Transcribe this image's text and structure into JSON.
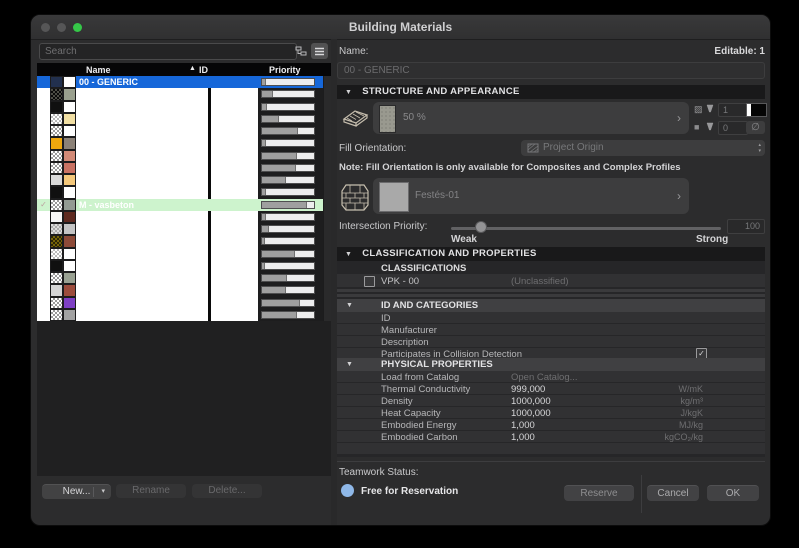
{
  "window": {
    "title": "Building Materials"
  },
  "icons": {
    "collapse": "▼",
    "chevron_right": "›",
    "checkmark": "✓",
    "empty_set": "∅",
    "sort_asc": "▲",
    "dropdown_chevron": "▾",
    "panel_collapse": "◀",
    "stepper_up": "▴",
    "stepper_down": "▾"
  },
  "colors": {
    "selection_blue": "#1667d9",
    "highlight_green": "#cdf3cd",
    "teamwork_status_blue": "#8fb8e8",
    "traffic_gray": "#565657",
    "traffic_green": "#35c748"
  },
  "left_panel": {
    "search_placeholder": "Search",
    "columns": {
      "name": "Name",
      "id": "ID",
      "priority": "Priority"
    },
    "rows": [
      {
        "name": "00 - GENERIC",
        "selected": true,
        "fill": {
          "type": "solid",
          "fg": "#22304e"
        },
        "surface": "#ffffff",
        "priority": 0.08
      },
      {
        "name": "",
        "fill": {
          "type": "checker",
          "fg": "#0a0a0a",
          "bg": "#4c4c44"
        },
        "surface": "#9aa08e",
        "priority": 0.22
      },
      {
        "name": "",
        "fill": {
          "type": "solid",
          "fg": "#101010"
        },
        "surface": "#ffffff",
        "priority": 0.1
      },
      {
        "name": "",
        "fill": {
          "type": "checker",
          "fg": "#b8b8b8",
          "bg": "#ffffff"
        },
        "surface": "#f1dfa3",
        "priority": 0.32
      },
      {
        "name": "",
        "fill": {
          "type": "checker",
          "fg": "#9a9a9a",
          "bg": "#ffffff"
        },
        "surface": "#ffffff",
        "priority": 0.7
      },
      {
        "name": "",
        "fill": {
          "type": "solid",
          "fg": "#efa70e"
        },
        "surface": "#8b8177",
        "priority": 0.08
      },
      {
        "name": "",
        "fill": {
          "type": "checker",
          "fg": "#9a9a9a",
          "bg": "#ffffff"
        },
        "surface": "#d38a77",
        "priority": 0.67
      },
      {
        "name": "",
        "fill": {
          "type": "checker",
          "fg": "#9a9a9a",
          "bg": "#ffffff"
        },
        "surface": "#c97263",
        "priority": 0.65
      },
      {
        "name": "",
        "fill": {
          "type": "solid",
          "fg": "#d9d9d9"
        },
        "surface": "#f4c87b",
        "priority": 0.47
      },
      {
        "name": "",
        "fill": {
          "type": "solid",
          "fg": "#101010"
        },
        "surface": "#ffffff",
        "priority": 0.08
      },
      {
        "name": "M - vasbeton",
        "highlighted": true,
        "checked": true,
        "fill": {
          "type": "checker",
          "fg": "#9a9a9a",
          "bg": "#ffffff"
        },
        "surface": "#929a92",
        "priority": 0.87
      },
      {
        "name": "",
        "fill": {
          "type": "solid",
          "fg": "#f6f6f6"
        },
        "surface": "#5e2a20",
        "priority": 0.08
      },
      {
        "name": "",
        "fill": {
          "type": "checker",
          "fg": "#ababab",
          "bg": "#dddddd"
        },
        "surface": "#c4c4c4",
        "priority": 0.14
      },
      {
        "name": "",
        "fill": {
          "type": "checker",
          "fg": "#756408",
          "bg": "#2c2607"
        },
        "surface": "#8d4a38",
        "priority": 0.05
      },
      {
        "name": "",
        "fill": {
          "type": "checker",
          "fg": "#bcbcbc",
          "bg": "#ffffff"
        },
        "surface": "#ffffff",
        "priority": 0.64
      },
      {
        "name": "",
        "fill": {
          "type": "solid",
          "fg": "#101010"
        },
        "surface": "#ffffff",
        "priority": 0.06
      },
      {
        "name": "",
        "fill": {
          "type": "checker",
          "fg": "#9a9a9a",
          "bg": "#ffffff"
        },
        "surface": "#99a192",
        "priority": 0.49
      },
      {
        "name": "",
        "fill": {
          "type": "solid",
          "fg": "#d4d4d4"
        },
        "surface": "#9c4c3c",
        "priority": 0.47
      },
      {
        "name": "",
        "fill": {
          "type": "checker",
          "fg": "#9a9a9a",
          "bg": "#ffffff"
        },
        "surface": "#7e3fc4",
        "priority": 0.74
      },
      {
        "name": "",
        "fill": {
          "type": "checker",
          "fg": "#9a9a9a",
          "bg": "#ffffff"
        },
        "surface": "#a2a2a2",
        "priority": 0.67
      }
    ],
    "buttons": {
      "new": "New...",
      "rename": "Rename",
      "delete": "Delete..."
    }
  },
  "right_panel": {
    "name_label": "Name:",
    "editable_label": "Editable: 1",
    "name_value": "00 - GENERIC",
    "structure": {
      "header": "STRUCTURE AND APPEARANCE",
      "fill_value": "50 %",
      "cut_fill_pens": {
        "foreground_pen": "1",
        "background_pen": "0"
      },
      "fill_orientation_label": "Fill Orientation:",
      "fill_orientation_value": "Project Origin",
      "note": "Note: Fill Orientation is only available for Composites and Complex Profiles",
      "surface_value": "Festés-01",
      "intersection_label": "Intersection Priority:",
      "intersection_value": "100",
      "weak_label": "Weak",
      "strong_label": "Strong"
    },
    "classification": {
      "header": "CLASSIFICATION AND PROPERTIES",
      "subheader": "CLASSIFICATIONS",
      "system": "VPK - 00",
      "value": "(Unclassified)"
    },
    "id_categories": {
      "header": "ID AND CATEGORIES",
      "rows": [
        {
          "label": "ID",
          "value": ""
        },
        {
          "label": "Manufacturer",
          "value": ""
        },
        {
          "label": "Description",
          "value": ""
        },
        {
          "label": "Participates in Collision Detection",
          "checkbox": true,
          "checked": true
        }
      ]
    },
    "physical": {
      "header": "PHYSICAL PROPERTIES",
      "rows": [
        {
          "label": "Load from Catalog",
          "value": "Open Catalog...",
          "value_muted": true,
          "unit": ""
        },
        {
          "label": "Thermal Conductivity",
          "value": "999,000",
          "unit": "W/mK"
        },
        {
          "label": "Density",
          "value": "1000,000",
          "unit": "kg/m³"
        },
        {
          "label": "Heat Capacity",
          "value": "1000,000",
          "unit": "J/kgK"
        },
        {
          "label": "Embodied Energy",
          "value": "1,000",
          "unit": "MJ/kg"
        },
        {
          "label": "Embodied Carbon",
          "value": "1,000",
          "unit": "kgCO₂/kg"
        }
      ]
    },
    "teamwork": {
      "label": "Teamwork Status:",
      "status": "Free for Reservation"
    },
    "buttons": {
      "reserve": "Reserve",
      "cancel": "Cancel",
      "ok": "OK"
    }
  }
}
